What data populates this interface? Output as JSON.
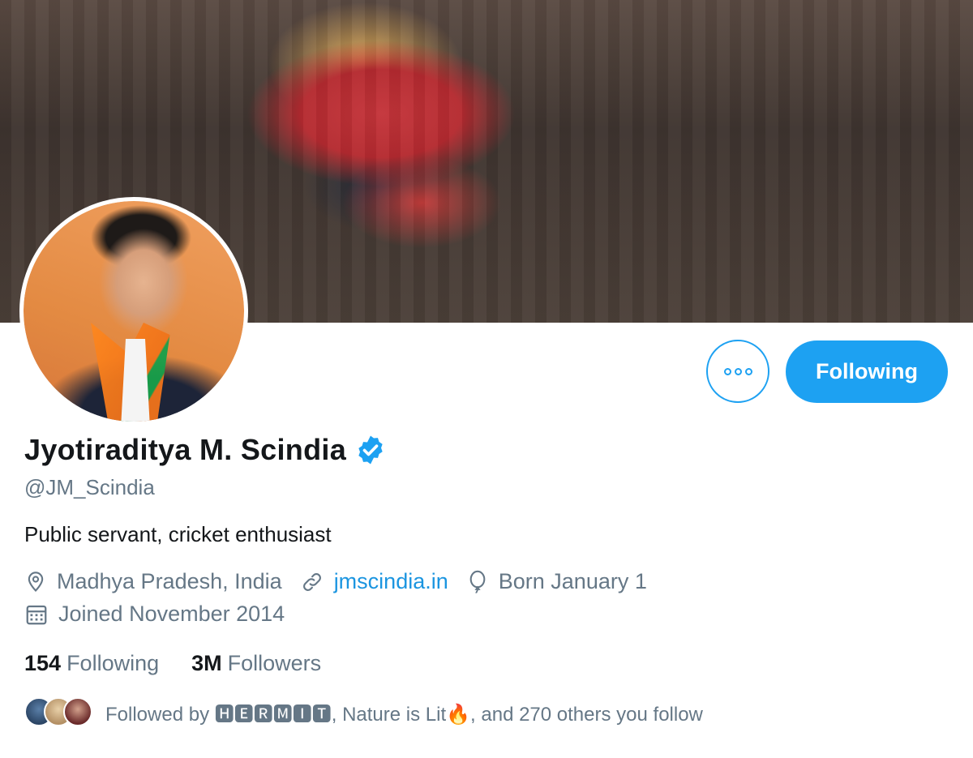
{
  "profile": {
    "name": "Jyotiraditya M. Scindia",
    "handle": "@JM_Scindia",
    "bio": "Public servant, cricket enthusiast",
    "location": "Madhya Pradesh, India",
    "website": "jmscindia.in",
    "birthday": "Born January 1",
    "joined": "Joined November 2014",
    "verified": true
  },
  "stats": {
    "following_count": "154",
    "following_label": "Following",
    "followers_count": "3M",
    "followers_label": "Followers"
  },
  "actions": {
    "follow_label": "Following"
  },
  "followed_by": {
    "prefix": "Followed by ",
    "name1": "🅷🅴🆁🅼🅸🆃",
    "sep": ", ",
    "name2": "Nature is Lit",
    "emoji": "🔥",
    "suffix": ", and 270 others you follow"
  },
  "icons": {
    "location": "location-pin-icon",
    "link": "link-icon",
    "birthday": "balloon-icon",
    "joined": "calendar-icon",
    "more": "more-dots-icon",
    "verified": "verified-badge-icon"
  },
  "colors": {
    "accent": "#1da1f2",
    "link": "#1b95e0",
    "secondary_text": "#657786",
    "primary_text": "#14171a"
  }
}
